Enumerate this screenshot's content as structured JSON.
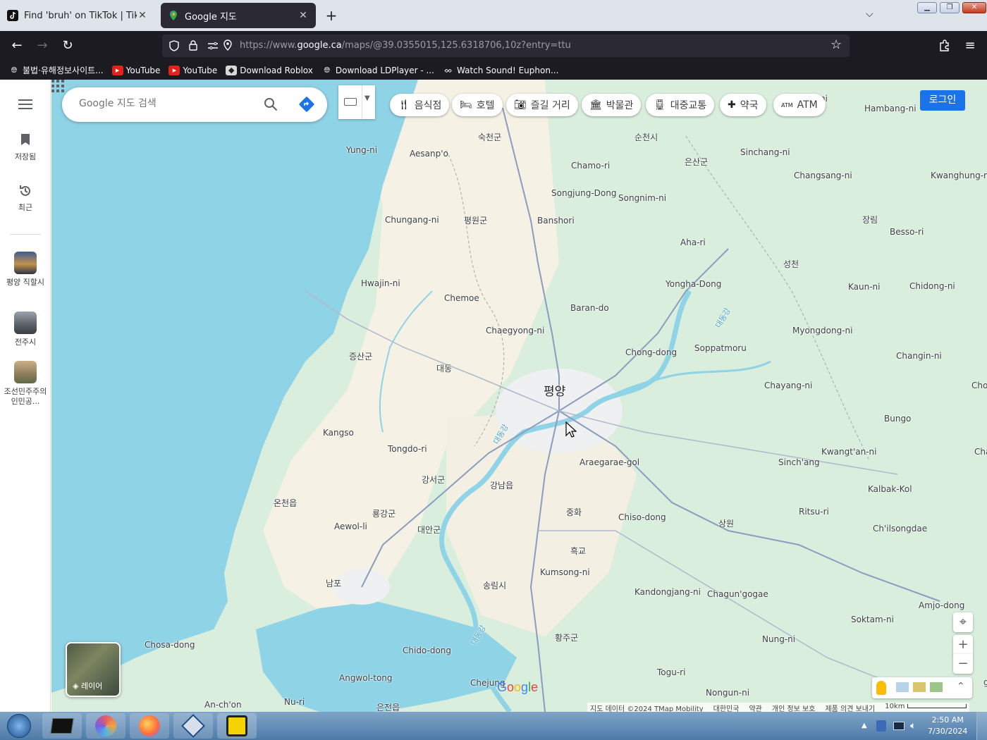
{
  "browser": {
    "tabs": [
      {
        "title": "Find 'bruh' on TikTok | TikTok Search",
        "close": "✕"
      },
      {
        "title": "Google 지도",
        "close": "✕"
      }
    ],
    "new_tab": "+",
    "url": {
      "domain_prefix": "https://www.",
      "domain": "google.ca",
      "path": "/maps/@39.0355015,125.6318706,10z?entry=ttu"
    },
    "bookmarks": [
      {
        "label": "불법·유해정보사이트...",
        "icon": "globe-icon"
      },
      {
        "label": "YouTube",
        "icon": "youtube-icon"
      },
      {
        "label": "YouTube",
        "icon": "youtube-icon"
      },
      {
        "label": "Download Roblox",
        "icon": "roblox-icon"
      },
      {
        "label": "Download LDPlayer - ...",
        "icon": "globe-icon"
      },
      {
        "label": "Watch Sound! Euphon...",
        "icon": "anime-icon"
      }
    ]
  },
  "rail": {
    "items": [
      {
        "label": "저장됨",
        "icon": "bookmark-icon"
      },
      {
        "label": "최근",
        "icon": "history-icon"
      }
    ],
    "recent": [
      {
        "label": "평양 직할시"
      },
      {
        "label": "전주시"
      },
      {
        "label": "조선민주주의인민공..."
      }
    ]
  },
  "search": {
    "placeholder": "Google 지도 검색"
  },
  "chips": [
    {
      "label": "음식점",
      "icon": "restaurant-icon"
    },
    {
      "label": "호텔",
      "icon": "hotel-icon"
    },
    {
      "label": "즐길 거리",
      "icon": "camera-icon"
    },
    {
      "label": "박물관",
      "icon": "museum-icon"
    },
    {
      "label": "대중교통",
      "icon": "transit-icon"
    },
    {
      "label": "약국",
      "icon": "pharmacy-icon"
    },
    {
      "label": "ATM",
      "icon": "atm-icon"
    }
  ],
  "login_label": "로그인",
  "layers_label": "레이어",
  "places": [
    {
      "name": "평양",
      "big": true
    },
    {
      "name": "숙천군"
    },
    {
      "name": "순천시"
    },
    {
      "name": "은산군"
    },
    {
      "name": "Yung-ni"
    },
    {
      "name": "Aesanp'o"
    },
    {
      "name": "Chamo-ri"
    },
    {
      "name": "Sinchang-ni"
    },
    {
      "name": "Changsang-ni"
    },
    {
      "name": "Kwanghung-ni"
    },
    {
      "name": "Hambang-ni"
    },
    {
      "name": "Songjung-Dong"
    },
    {
      "name": "Songnim-ni"
    },
    {
      "name": "Chungang-ni"
    },
    {
      "name": "평원군"
    },
    {
      "name": "Banshori"
    },
    {
      "name": "장림"
    },
    {
      "name": "Besso-ri"
    },
    {
      "name": "Aha-ri"
    },
    {
      "name": "성천"
    },
    {
      "name": "Hwajin-ni"
    },
    {
      "name": "Chemoe"
    },
    {
      "name": "Yongha-Dong"
    },
    {
      "name": "Kaun-ni"
    },
    {
      "name": "Chidong-ni"
    },
    {
      "name": "Baran-do"
    },
    {
      "name": "Chaegyong-ni"
    },
    {
      "name": "Myongdong-ni"
    },
    {
      "name": "증산군"
    },
    {
      "name": "Chong-dong"
    },
    {
      "name": "Soppatmoru"
    },
    {
      "name": "대동"
    },
    {
      "name": "Changin-ni"
    },
    {
      "name": "Chayang-ni"
    },
    {
      "name": "Chongs"
    },
    {
      "name": "Bungo"
    },
    {
      "name": "Kangso"
    },
    {
      "name": "Tongdo-ri"
    },
    {
      "name": "Araegarae-gol"
    },
    {
      "name": "Kwangt'an-ni"
    },
    {
      "name": "Chaeh"
    },
    {
      "name": "Sinch'ang"
    },
    {
      "name": "강서군"
    },
    {
      "name": "강남읍"
    },
    {
      "name": "Kalbak-Kol"
    },
    {
      "name": "온천읍"
    },
    {
      "name": "룡강군"
    },
    {
      "name": "중화"
    },
    {
      "name": "Ritsu-ri"
    },
    {
      "name": "Aewol-li"
    },
    {
      "name": "대안군"
    },
    {
      "name": "Chiso-dong"
    },
    {
      "name": "상원"
    },
    {
      "name": "Ch'ilsongdae"
    },
    {
      "name": "흑교"
    },
    {
      "name": "Kumsong-ni"
    },
    {
      "name": "남포"
    },
    {
      "name": "송림시"
    },
    {
      "name": "Kandongjang-ni"
    },
    {
      "name": "Chagun'gogae"
    },
    {
      "name": "Amjo-dong"
    },
    {
      "name": "Soktam-ni"
    },
    {
      "name": "황주군"
    },
    {
      "name": "Chosa-dong"
    },
    {
      "name": "Chido-dong"
    },
    {
      "name": "Nung-ni"
    },
    {
      "name": "Angwol-tong"
    },
    {
      "name": "Chejung"
    },
    {
      "name": "Togu-ri"
    },
    {
      "name": "Nongun-ni"
    },
    {
      "name": "An-ch'on"
    },
    {
      "name": "Nu-ri"
    },
    {
      "name": "은전읍"
    },
    {
      "name": "대동강"
    },
    {
      "name": "대동강"
    },
    {
      "name": "대동강"
    },
    {
      "name": "ni"
    },
    {
      "name": "g-ni"
    }
  ],
  "footer": {
    "items": [
      "지도 데이터 ©2024 TMap Mobility",
      "대한민국",
      "약관",
      "개인 정보 보호",
      "제품 의견 보내기"
    ],
    "scale": "10km"
  },
  "google_logo": "Google",
  "taskbar": {
    "time": "2:50 AM",
    "date": "7/30/2024",
    "apps": [
      "windows-start-icon",
      "terminal-icon",
      "chrome-like-icon",
      "firefox-icon",
      "virtualbox-icon",
      "roblox-studio-icon"
    ]
  },
  "colors": {
    "water": "#8fd3e6",
    "land": "#d9eedd",
    "urban": "#f1f3f4",
    "accent": "#1a73e8",
    "road": "#8c9cbf"
  }
}
